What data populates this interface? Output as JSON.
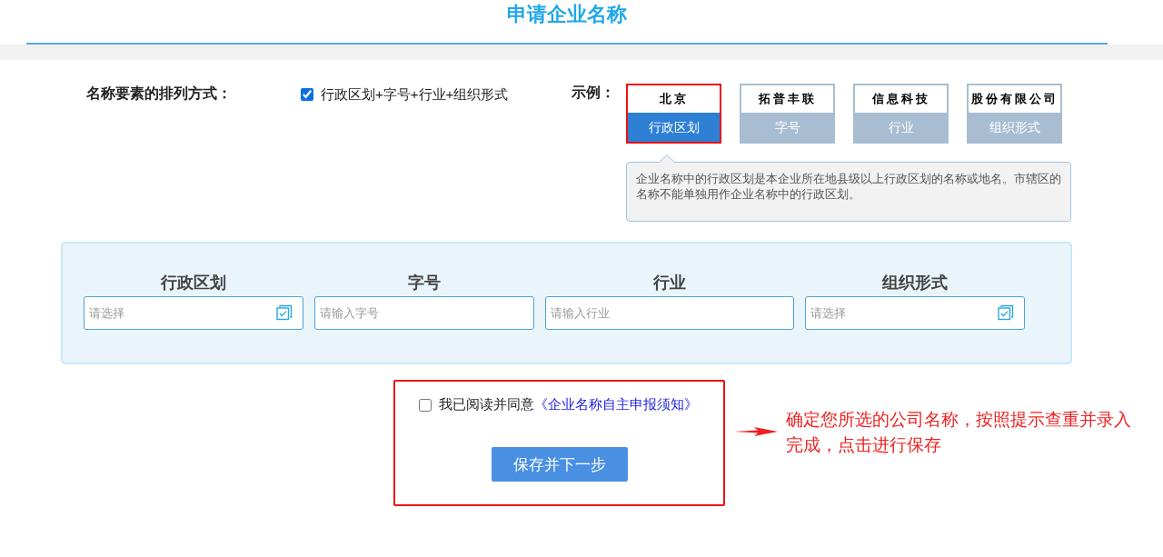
{
  "page": {
    "title": "申请企业名称"
  },
  "arrangement": {
    "label": "名称要素的排列方式：",
    "option": {
      "label": "行政区划+字号+行业+组织形式",
      "checked": true
    }
  },
  "example": {
    "label": "示例：",
    "cards": [
      {
        "sample": "北京",
        "caption": "行政区划",
        "selected": true
      },
      {
        "sample": "拓普丰联",
        "caption": "字号",
        "selected": false
      },
      {
        "sample": "信息科技",
        "caption": "行业",
        "selected": false
      },
      {
        "sample": "股份有限公司",
        "caption": "组织形式",
        "selected": false
      }
    ],
    "tooltip": "企业名称中的行政区划是本企业所在地县级以上行政区划的名称或地名。市辖区的名称不能单独用作企业名称中的行政区划。"
  },
  "fields": [
    {
      "label": "行政区划",
      "placeholder": "请选择",
      "kind": "select"
    },
    {
      "label": "字号",
      "placeholder": "请输入字号",
      "kind": "text"
    },
    {
      "label": "行业",
      "placeholder": "请输入行业",
      "kind": "text"
    },
    {
      "label": "组织形式",
      "placeholder": "请选择",
      "kind": "select"
    }
  ],
  "agreement": {
    "text": "我已阅读并同意",
    "link": "《企业名称自主申报须知》",
    "checked": false
  },
  "submit_button": "保存并下一步",
  "annotation": "确定您所选的公司名称，按照提示查重并录入完成，点击进行保存"
}
